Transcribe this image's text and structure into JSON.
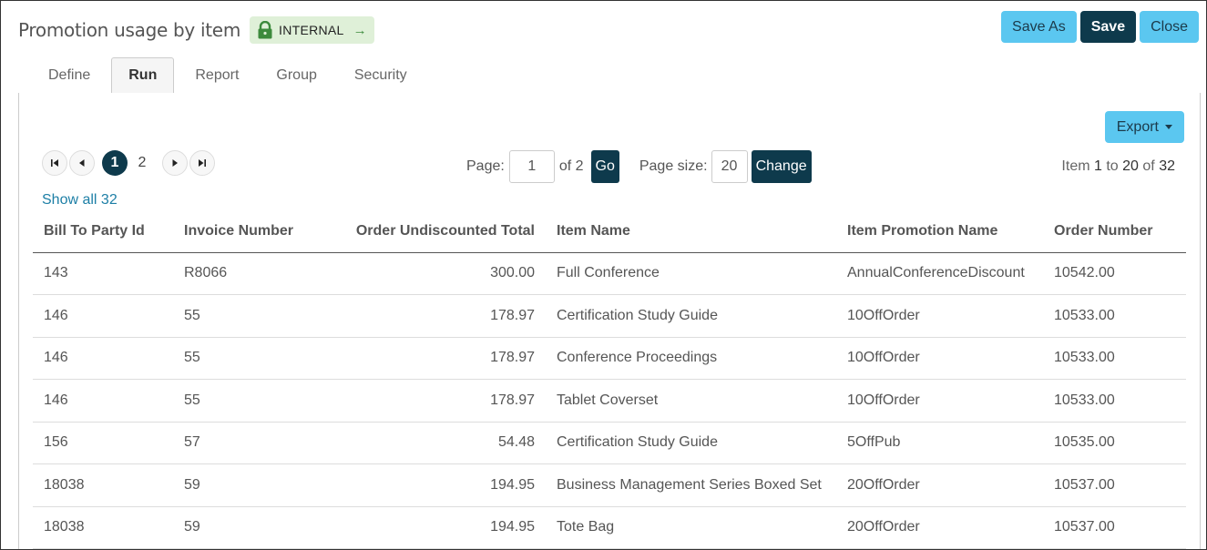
{
  "header": {
    "title": "Promotion usage by item",
    "badge_label": "INTERNAL",
    "badge_arrow": "→"
  },
  "toolbar": {
    "save_as_label": "Save As",
    "save_label": "Save",
    "close_label": "Close"
  },
  "tabs": [
    {
      "label": "Define",
      "active": false
    },
    {
      "label": "Run",
      "active": true
    },
    {
      "label": "Report",
      "active": false
    },
    {
      "label": "Group",
      "active": false
    },
    {
      "label": "Security",
      "active": false
    }
  ],
  "export": {
    "label": "Export"
  },
  "pager": {
    "pages": [
      "1",
      "2"
    ],
    "current_page": "1",
    "page_label": "Page:",
    "page_value": "1",
    "of_label": "of 2",
    "go_label": "Go",
    "size_label": "Page size:",
    "size_value": "20",
    "change_label": "Change",
    "item_prefix": "Item",
    "item_from": "1",
    "item_to_label": "to",
    "item_to": "20",
    "item_of_label": "of",
    "item_total": "32"
  },
  "show_all_label": "Show all 32",
  "table": {
    "columns": [
      "Bill To Party Id",
      "Invoice Number",
      "Order Undiscounted Total",
      "Item Name",
      "Item Promotion Name",
      "Order Number"
    ],
    "rows": [
      [
        "143",
        "R8066",
        "300.00",
        "Full Conference",
        "AnnualConferenceDiscount",
        "10542.00"
      ],
      [
        "146",
        "55",
        "178.97",
        "Certification Study Guide",
        "10OffOrder",
        "10533.00"
      ],
      [
        "146",
        "55",
        "178.97",
        "Conference Proceedings",
        "10OffOrder",
        "10533.00"
      ],
      [
        "146",
        "55",
        "178.97",
        "Tablet Coverset",
        "10OffOrder",
        "10533.00"
      ],
      [
        "156",
        "57",
        "54.48",
        "Certification Study Guide",
        "5OffPub",
        "10535.00"
      ],
      [
        "18038",
        "59",
        "194.95",
        "Business Management Series Boxed Set",
        "20OffOrder",
        "10537.00"
      ],
      [
        "18038",
        "59",
        "194.95",
        "Tote Bag",
        "20OffOrder",
        "10537.00"
      ]
    ]
  }
}
